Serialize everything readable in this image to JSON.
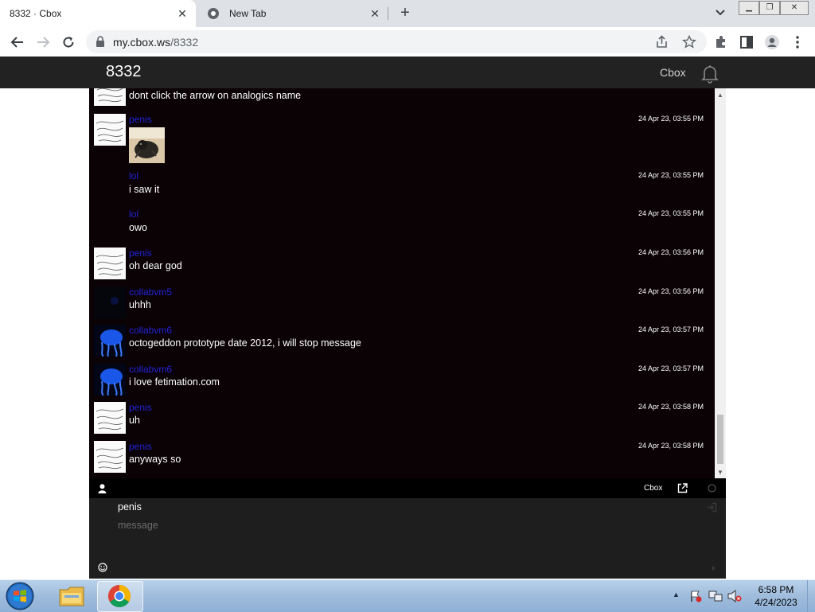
{
  "browser": {
    "tabs": [
      {
        "title": "8332 · Cbox",
        "active": true
      },
      {
        "title": "New Tab",
        "active": false
      }
    ],
    "close_glyph": "✕",
    "new_tab_glyph": "+",
    "url_host": "my.cbox.ws",
    "url_path": "/8332"
  },
  "site": {
    "title": "8332",
    "brand": "Cbox"
  },
  "chat": {
    "messages": [
      {
        "user": "",
        "text": "dont click the arrow on analogics name",
        "time": "",
        "avatar": "sketch"
      },
      {
        "user": "penis",
        "text": "",
        "time": "24 Apr 23, 03:55 PM",
        "avatar": "sketch",
        "attachment": "cat-photo"
      },
      {
        "user": "lol",
        "text": "i saw it",
        "time": "24 Apr 23, 03:55 PM",
        "avatar": "none"
      },
      {
        "user": "lol",
        "text": "owo",
        "time": "24 Apr 23, 03:55 PM",
        "avatar": "none"
      },
      {
        "user": "penis",
        "text": "oh dear god",
        "time": "24 Apr 23, 03:56 PM",
        "avatar": "sketch"
      },
      {
        "user": "collabvm5",
        "text": "uhhh",
        "time": "24 Apr 23, 03:56 PM",
        "avatar": "dark-blue"
      },
      {
        "user": "collabvm6",
        "text": "octogeddon prototype date 2012, i will stop message",
        "time": "24 Apr 23, 03:57 PM",
        "avatar": "jellyfish"
      },
      {
        "user": "collabvm6",
        "text": "i love fetimation.com",
        "time": "24 Apr 23, 03:57 PM",
        "avatar": "jellyfish"
      },
      {
        "user": "penis",
        "text": "uh",
        "time": "24 Apr 23, 03:58 PM",
        "avatar": "sketch"
      },
      {
        "user": "penis",
        "text": "anyways so",
        "time": "24 Apr 23, 03:58 PM",
        "avatar": "sketch"
      }
    ],
    "bar": {
      "brand": "Cbox"
    },
    "form": {
      "name": "penis",
      "message_placeholder": "message"
    }
  },
  "taskbar": {
    "time": "6:58 PM",
    "date": "4/24/2023"
  },
  "colors": {
    "chat_bg": "#0a0204",
    "username": "#2323d9",
    "header_bg": "#222222"
  }
}
